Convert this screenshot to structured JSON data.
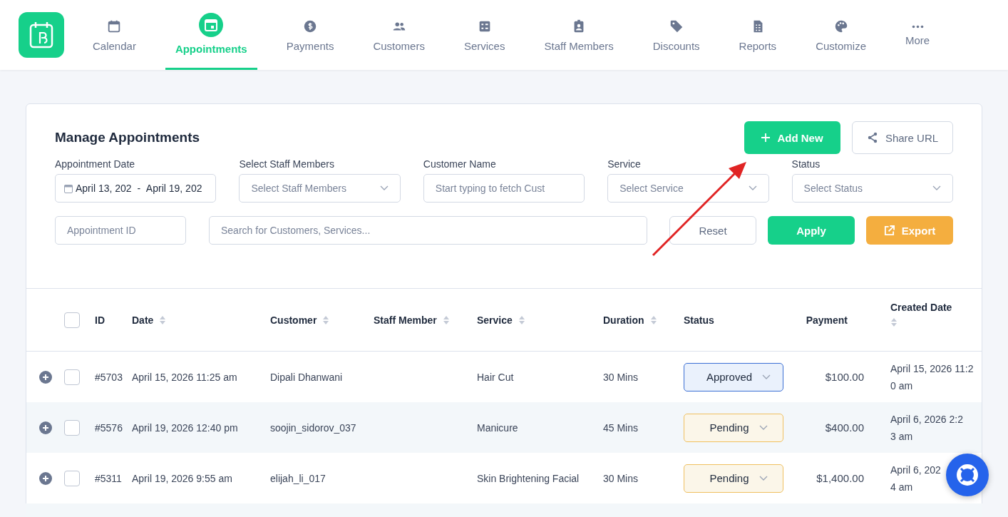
{
  "nav": {
    "items": [
      {
        "label": "Calendar",
        "selected": false
      },
      {
        "label": "Appointments",
        "selected": true
      },
      {
        "label": "Payments",
        "selected": false
      },
      {
        "label": "Customers",
        "selected": false
      },
      {
        "label": "Services",
        "selected": false
      },
      {
        "label": "Staff Members",
        "selected": false
      },
      {
        "label": "Discounts",
        "selected": false
      },
      {
        "label": "Reports",
        "selected": false
      },
      {
        "label": "Customize",
        "selected": false
      },
      {
        "label": "More",
        "selected": false
      }
    ]
  },
  "panel": {
    "title": "Manage Appointments",
    "actions": [
      "Add New",
      "Share URL"
    ],
    "filters": [
      {
        "label": "Appointment Date",
        "kind": "daterange",
        "start": "April 13, 202",
        "separator": "-",
        "end": "April 19, 202"
      },
      {
        "label": "Select Staff Members",
        "kind": "select",
        "placeholder": "Select Staff Members"
      },
      {
        "label": "Customer Name",
        "kind": "text",
        "placeholder": "Start typing to fetch Cust"
      },
      {
        "label": "Service",
        "kind": "select",
        "placeholder": "Select Service"
      },
      {
        "label": "Status",
        "kind": "select",
        "placeholder": "Select Status"
      }
    ],
    "id_field": {
      "placeholder": "Appointment ID"
    },
    "search_field": {
      "placeholder": "Search for Customers, Services..."
    },
    "buttons": [
      "Reset",
      "Apply",
      "Export"
    ]
  },
  "table": {
    "select_all": {
      "checked": false
    },
    "columns": [
      {
        "label": "ID",
        "sortable": false
      },
      {
        "label": "Date",
        "sortable": true
      },
      {
        "label": "Customer",
        "sortable": true
      },
      {
        "label": "Staff Member",
        "sortable": true
      },
      {
        "label": "Service",
        "sortable": true
      },
      {
        "label": "Duration",
        "sortable": true
      },
      {
        "label": "Status",
        "sortable": false
      },
      {
        "label": "Payment",
        "sortable": false
      },
      {
        "label": "Created Date",
        "sortable": true
      }
    ],
    "rows": [
      {
        "checked": false,
        "id": "#5703",
        "date": "April 15, 2026 11:25 am",
        "customer": "Dipali Dhanwani",
        "service": "Hair Cut",
        "duration": "30 Mins",
        "status": "Approved",
        "kind": "approved",
        "payment": "$100.00",
        "created": [
          "April 15, 2026 11:2",
          "0 am"
        ]
      },
      {
        "checked": false,
        "id": "#5576",
        "date": "April 19, 2026 12:40 pm",
        "customer": "soojin_sidorov_037",
        "service": "Manicure",
        "duration": "45 Mins",
        "status": "Pending",
        "kind": "pending",
        "payment": "$400.00",
        "created": [
          "April 6, 2026 2:2",
          "3 am"
        ]
      },
      {
        "checked": false,
        "id": "#5311",
        "date": "April 19, 2026 9:55 am",
        "customer": "elijah_li_017",
        "service": "Skin Brightening Facial",
        "duration": "30 Mins",
        "status": "Pending",
        "kind": "pending",
        "payment": "$1,400.00",
        "created": [
          "April 6, 202",
          "4 am"
        ]
      }
    ]
  }
}
